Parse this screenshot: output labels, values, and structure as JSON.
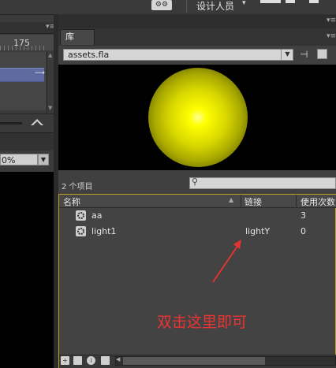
{
  "topbar": {
    "settings_icon": "gear-icon",
    "workspace_label": "设计人员",
    "workspace_arrow": "▾"
  },
  "timeline": {
    "frame_number": "175",
    "panel_menu": "▾≡"
  },
  "stage": {
    "zoom_value": "0%",
    "zoom_arrow": "▼"
  },
  "library": {
    "tab_label": "库",
    "panel_menu": "▾≡",
    "document_select": "assets.fla",
    "document_arrow": "▼",
    "pin_icon": "pin-icon",
    "preview_symbol": "yellow radial light",
    "item_count": "2 个项目",
    "search_placeholder": "",
    "columns": {
      "name": "名称",
      "linkage": "链接",
      "use_count": "使用次数"
    },
    "items": [
      {
        "name": "aa",
        "linkage": "",
        "use_count": "3",
        "icon": "movieclip-icon"
      },
      {
        "name": "light1",
        "linkage": "lightY",
        "use_count": "0",
        "icon": "movieclip-icon"
      }
    ]
  },
  "annotation": {
    "text": "双击这里即可",
    "color": "#e33333"
  },
  "colors": {
    "panel_bg": "#404040",
    "selection_border": "#c0a020",
    "timeline_selection": "#5f6ba0",
    "preview_glow": "#ffff00"
  }
}
